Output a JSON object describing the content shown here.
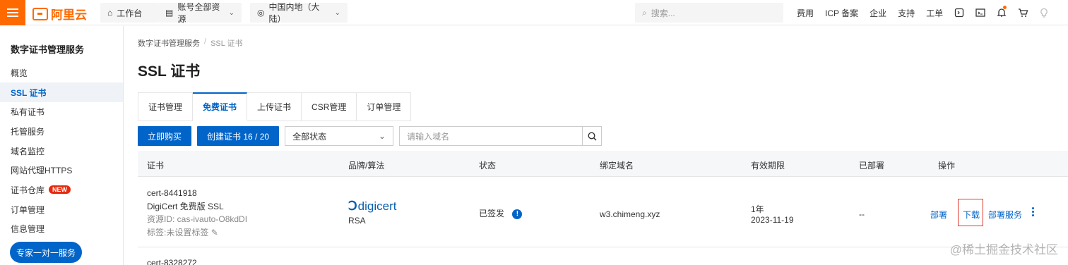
{
  "topbar": {
    "logo_text": "阿里云",
    "workbench": "工作台",
    "resources": "账号全部资源",
    "region": "中国内地（大陆）",
    "search_placeholder": "搜索...",
    "links": [
      "费用",
      "ICP 备案",
      "企业",
      "支持",
      "工单"
    ],
    "accent_color": "#ff6a00"
  },
  "sidebar": {
    "title": "数字证书管理服务",
    "items": [
      {
        "label": "概览"
      },
      {
        "label": "SSL 证书"
      },
      {
        "label": "私有证书"
      },
      {
        "label": "托管服务"
      },
      {
        "label": "域名监控"
      },
      {
        "label": "网站代理HTTPS"
      },
      {
        "label": "证书仓库",
        "badge": "NEW"
      },
      {
        "label": "订单管理"
      },
      {
        "label": "信息管理"
      }
    ],
    "expert_button": "专家一对一服务"
  },
  "main": {
    "breadcrumb": [
      "数字证书管理服务",
      "SSL 证书"
    ],
    "title": "SSL 证书",
    "tabs": [
      "证书管理",
      "免费证书",
      "上传证书",
      "CSR管理",
      "订单管理"
    ],
    "toolbar": {
      "buy": "立即购买",
      "create": "创建证书 16 / 20",
      "status_select": "全部状态",
      "domain_placeholder": "请输入域名"
    },
    "columns": [
      "证书",
      "品牌/算法",
      "状态",
      "绑定域名",
      "有效期限",
      "已部署",
      "操作"
    ],
    "rows": [
      {
        "cert_id": "cert-8441918",
        "cert_type": "DigiCert 免费版 SSL",
        "resource_id": "资源ID: cas-ivauto-O8kdDI",
        "tag": "标签:未设置标签",
        "brand": "digicert",
        "algorithm": "RSA",
        "status": "已签发",
        "domain": "w3.chimeng.xyz",
        "validity": "1年",
        "expiry": "2023-11-19",
        "deployed": "--",
        "actions": [
          "部署",
          "下载",
          "部署服务"
        ]
      },
      {
        "cert_id": "cert-8328272"
      }
    ]
  },
  "watermark": "@稀土掘金技术社区"
}
